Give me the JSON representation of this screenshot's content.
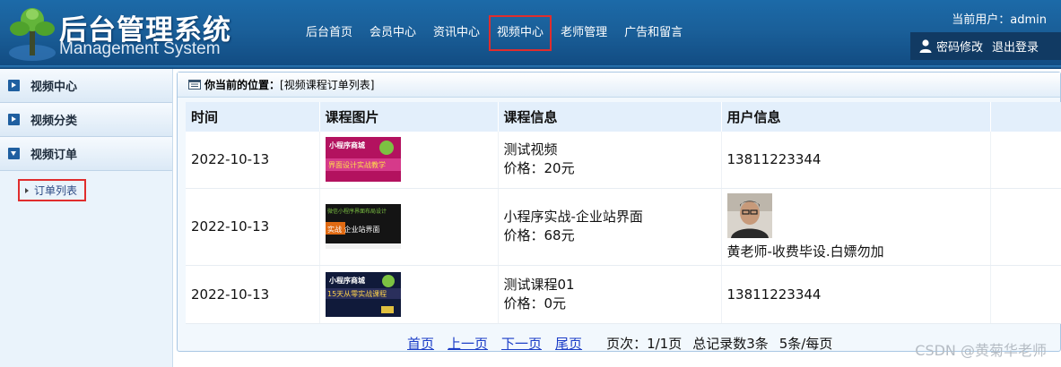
{
  "header": {
    "brand_cn": "后台管理系统",
    "brand_en": "Management System",
    "nav": [
      "后台首页",
      "会员中心",
      "资讯中心",
      "视频中心",
      "老师管理",
      "广告和留言"
    ],
    "active_nav": "视频中心",
    "current_user": "当前用户：admin",
    "change_password": "密码修改",
    "logout": "退出登录"
  },
  "sidebar": {
    "sections": [
      "视频中心",
      "视频分类",
      "视频订单"
    ],
    "sub_item": "订单列表"
  },
  "breadcrumb": {
    "label": "你当前的位置：",
    "path": "[视频课程订单列表]"
  },
  "table": {
    "headers": [
      "时间",
      "课程图片",
      "课程信息",
      "用户信息"
    ],
    "rows": [
      {
        "date": "2022-10-13",
        "thumb": {
          "top": "小程序商城",
          "main": "界面设计实战教学",
          "colors": [
            "#b3125f",
            "#d63a8a"
          ]
        },
        "course": "测试视频",
        "price": "价格：20元",
        "user": "13811223344",
        "avatar": false
      },
      {
        "date": "2022-10-13",
        "thumb": {
          "top": "微信小程序界面布局设计",
          "main": "实战 企业站界面",
          "colors": [
            "#141414",
            "#2b2b2b"
          ]
        },
        "course": "小程序实战-企业站界面",
        "price": "价格：68元",
        "user": "黄老师-收费毕设.白嫖勿加",
        "avatar": true
      },
      {
        "date": "2022-10-13",
        "thumb": {
          "top": "小程序商城",
          "main": "15天从零实战课程",
          "colors": [
            "#101a3a",
            "#2a2f5c"
          ]
        },
        "course": "测试课程01",
        "price": "价格：0元",
        "user": "13811223344",
        "avatar": false
      }
    ]
  },
  "pager": {
    "first": "首页",
    "prev": "上一页",
    "next": "下一页",
    "last": "尾页",
    "page": "页次：1/1页",
    "total": "总记录数3条",
    "per_page": "5条/每页"
  },
  "watermark": "CSDN @黄菊华老师",
  "colors": {
    "header_blue": "#1a5f99",
    "highlight_red": "#e02d2d",
    "link_blue": "#1a3cc7"
  }
}
